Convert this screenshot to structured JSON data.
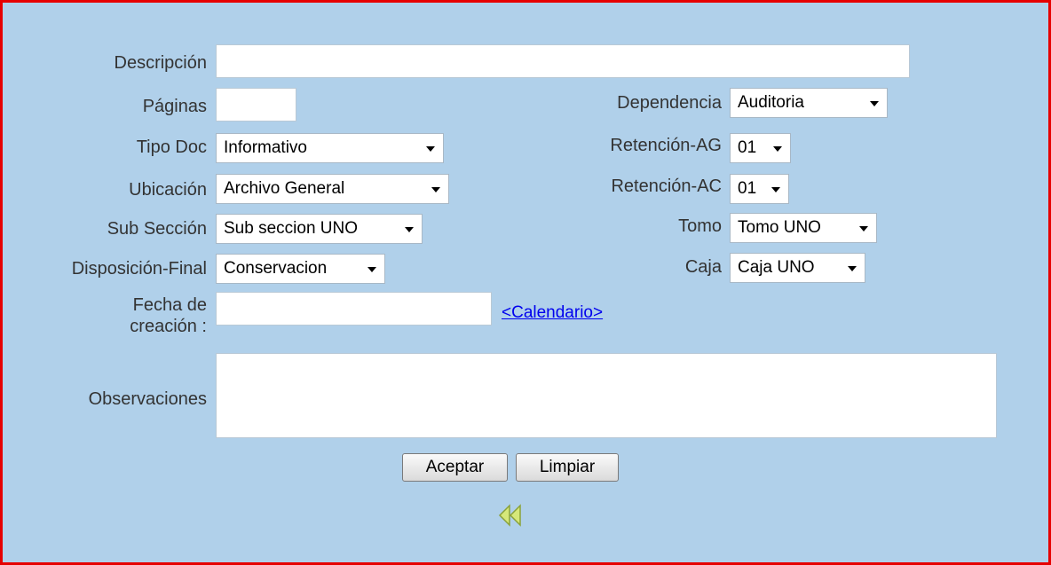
{
  "form": {
    "descripcion": {
      "label": "Descripción",
      "value": ""
    },
    "paginas": {
      "label": "Páginas",
      "value": ""
    },
    "dependencia": {
      "label": "Dependencia",
      "selected": "Auditoria"
    },
    "tipo_doc": {
      "label": "Tipo Doc",
      "selected": "Informativo"
    },
    "retencion_ag": {
      "label": "Retención-AG",
      "selected": "01"
    },
    "ubicacion": {
      "label": "Ubicación",
      "selected": "Archivo General"
    },
    "retencion_ac": {
      "label": "Retención-AC",
      "selected": "01"
    },
    "sub_seccion": {
      "label": "Sub Sección",
      "selected": "Sub seccion UNO"
    },
    "tomo": {
      "label": "Tomo",
      "selected": "Tomo UNO"
    },
    "disposicion_final": {
      "label": "Disposición-Final",
      "selected": "Conservacion"
    },
    "caja": {
      "label": "Caja",
      "selected": "Caja UNO"
    },
    "fecha_creacion": {
      "label_line1": "Fecha de",
      "label_line2": "creación :",
      "value": "",
      "calendar_link": "<Calendario>"
    },
    "observaciones": {
      "label": "Observaciones",
      "value": ""
    }
  },
  "buttons": {
    "accept": "Aceptar",
    "clear": "Limpiar"
  },
  "icons": {
    "back": "back-arrow-icon"
  },
  "colors": {
    "background": "#b0d0ea",
    "border": "#e60000",
    "link": "#0000ee",
    "back_icon": "#d6e87a"
  }
}
